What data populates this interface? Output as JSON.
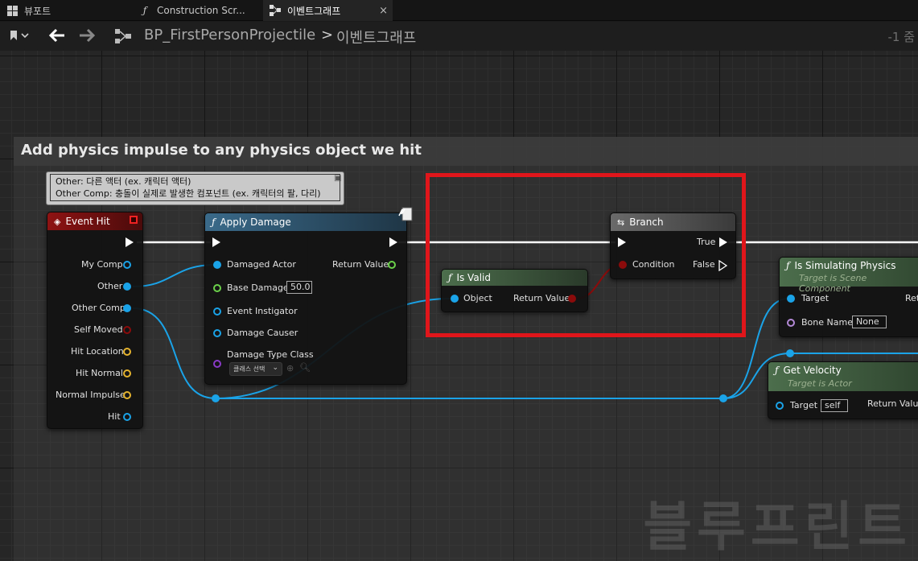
{
  "tabs": [
    {
      "label": "뷰포트",
      "icon": "viewport-icon"
    },
    {
      "label": "Construction Scr...",
      "icon": "function-icon"
    },
    {
      "label": "이벤트그래프",
      "icon": "graph-icon",
      "close": "×"
    }
  ],
  "breadcrumb": {
    "blueprint": "BP_FirstPersonProjectile",
    "separator": ">",
    "graph": "이벤트그래프"
  },
  "zoom": "-1 줌",
  "comment": {
    "title": "Add physics impulse to any physics object we hit"
  },
  "tooltip": {
    "line1": "Other: 다른 액터 (ex. 캐릭터 액터)",
    "line2": "Other Comp: 충돌이 실제로 발생한 컴포넌트 (ex. 캐릭터의 팔, 다리)"
  },
  "event_hit": {
    "title": "Event Hit",
    "pins": [
      "My Comp",
      "Other",
      "Other Comp",
      "Self Moved",
      "Hit Location",
      "Hit Normal",
      "Normal Impulse",
      "Hit"
    ]
  },
  "apply_damage": {
    "title": "Apply Damage",
    "inputs": [
      "Damaged Actor",
      "Base Damage",
      "Event Instigator",
      "Damage Causer",
      "Damage Type Class"
    ],
    "base_damage_value": "50.0",
    "class_select": "클래스 선택",
    "output": "Return Value"
  },
  "is_valid": {
    "title": "Is Valid",
    "input": "Object",
    "output": "Return Value"
  },
  "branch": {
    "title": "Branch",
    "condition": "Condition",
    "true_label": "True",
    "false_label": "False"
  },
  "is_simulating": {
    "title": "Is Simulating Physics",
    "subtitle": "Target is Scene Component",
    "target": "Target",
    "bone_name": "Bone Name",
    "bone_value": "None",
    "ret": "Ret"
  },
  "get_velocity": {
    "title": "Get Velocity",
    "subtitle": "Target is Actor",
    "target": "Target",
    "target_value": "self",
    "output": "Return Value"
  },
  "watermark": "블루프린트",
  "colors": {
    "exec": "#ffffff",
    "object": "#1aa3e8",
    "float": "#6bd14a",
    "bool": "#8b0b0b",
    "vector": "#e6b42e",
    "purple": "#8a3ac8",
    "highlight": "#e0161b"
  }
}
